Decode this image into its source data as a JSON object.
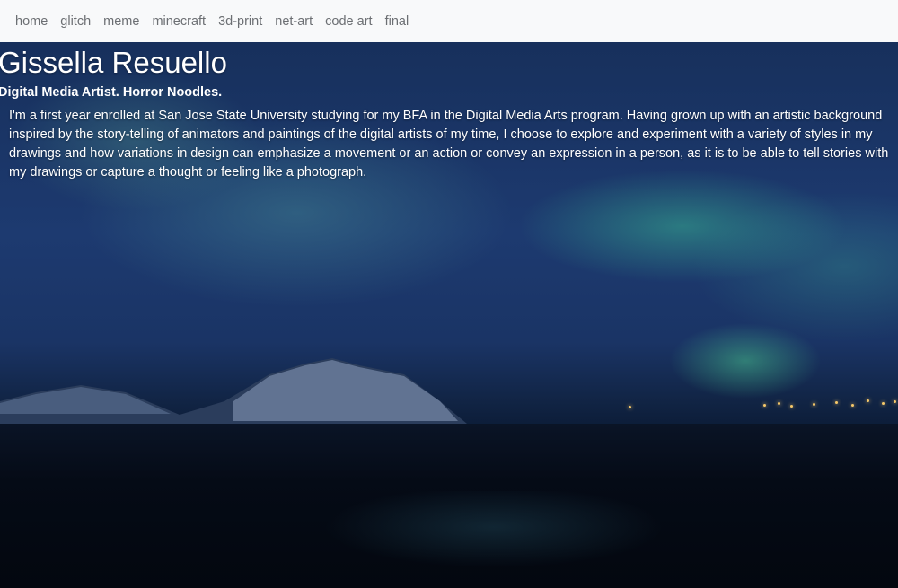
{
  "nav": {
    "items": [
      "home",
      "glitch",
      "meme",
      "minecraft",
      "3d-print",
      "net-art",
      "code art",
      "final"
    ]
  },
  "hero": {
    "title": "Gissella Resuello",
    "subtitle": "Digital Media Artist. Horror Noodles.",
    "bio": "I'm a first year enrolled at San Jose State University studying for my BFA in the Digital Media Arts program. Having grown up with an artistic background inspired by the story-telling of animators and paintings of the digital artists of my time, I choose to explore and experiment with a variety of styles in my drawings and how variations in design can emphasize a movement or an action or convey an expression in a person, as it is to be able to tell stories with my drawings or capture a thought or feeling like a photograph."
  },
  "colors": {
    "navbar_bg": "#f8f9fa",
    "nav_link": "#6c6f73",
    "hero_text": "#ffffff"
  }
}
